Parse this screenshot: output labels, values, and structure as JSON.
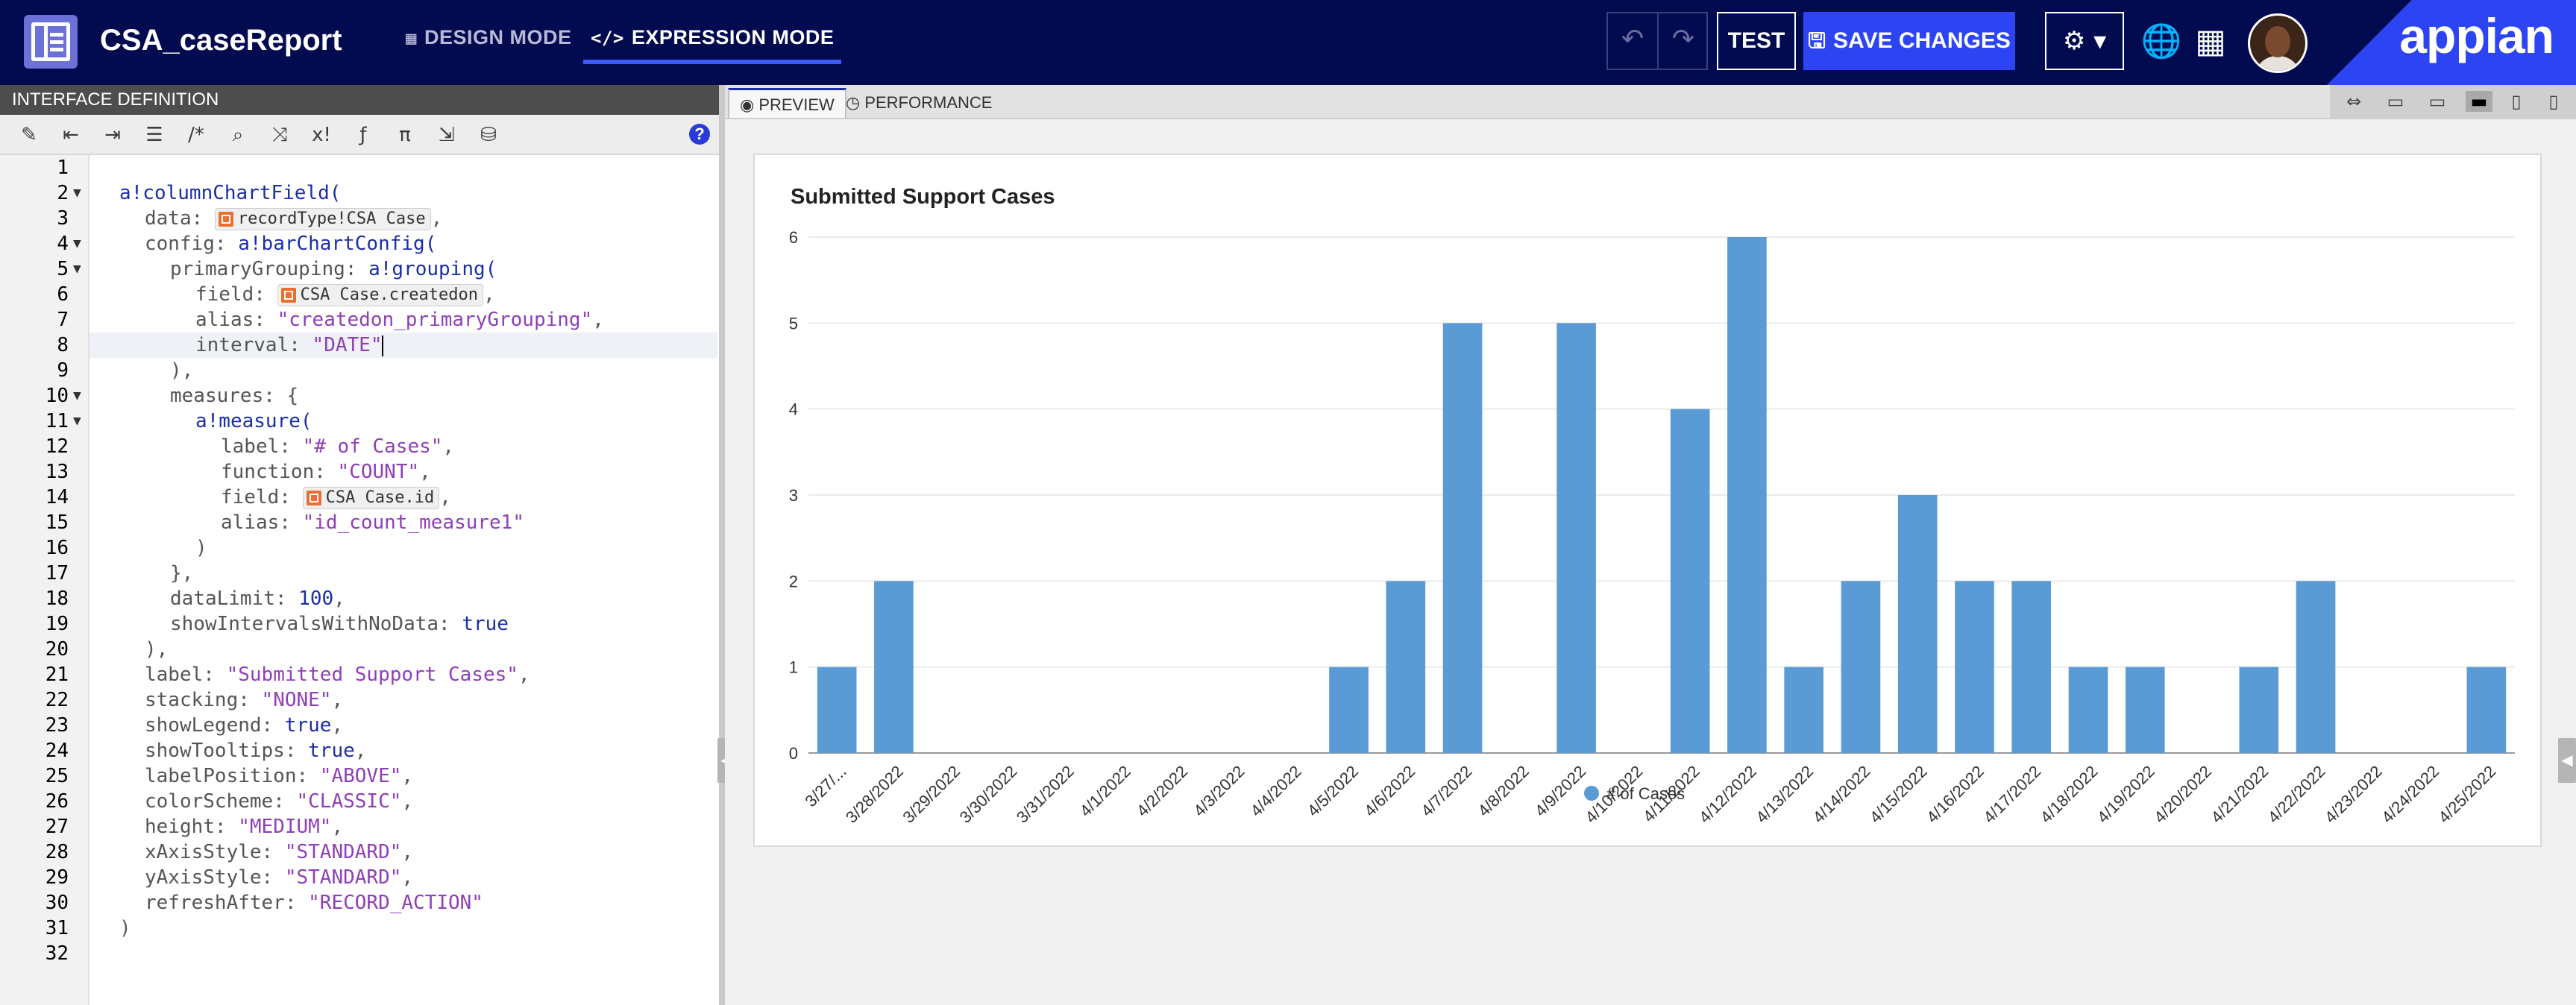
{
  "header": {
    "app_title": "CSA_caseReport",
    "design_mode": "DESIGN MODE",
    "expression_mode": "EXPRESSION MODE",
    "test": "TEST",
    "save": "SAVE CHANGES",
    "brand": "appian"
  },
  "left_panel": {
    "title": "INTERFACE DEFINITION",
    "tools": [
      "wand-icon",
      "outdent-icon",
      "indent-icon",
      "list-icon",
      "comment-icon",
      "search-icon",
      "shuffle-icon",
      "x-exclaim-icon",
      "fx-icon",
      "pi-icon",
      "export-icon",
      "database-search-icon"
    ],
    "line_numbers": [
      "1",
      "2",
      "3",
      "4",
      "5",
      "6",
      "7",
      "8",
      "9",
      "10",
      "11",
      "12",
      "13",
      "14",
      "15",
      "16",
      "17",
      "18",
      "19",
      "20",
      "21",
      "22",
      "23",
      "24",
      "25",
      "26",
      "27",
      "28",
      "29",
      "30",
      "31",
      "32"
    ],
    "code": {
      "l2_fn": "a!columnChartField(",
      "l3_key": "data: ",
      "l3_token": "recordType!CSA Case",
      "l3_end": ",",
      "l4_key": "config: ",
      "l4_fn": "a!barChartConfig(",
      "l5_key": "primaryGrouping: ",
      "l5_fn": "a!grouping(",
      "l6_key": "field: ",
      "l6_token": "CSA Case.createdon",
      "l6_end": ",",
      "l7_key": "alias: ",
      "l7_val": "\"createdon_primaryGrouping\"",
      "l7_end": ",",
      "l8_key": "interval: ",
      "l8_val": "\"DATE\"",
      "l9": "),",
      "l10_key": "measures: ",
      "l10_end": "{",
      "l11_fn": "a!measure(",
      "l12_key": "label: ",
      "l12_val": "\"# of Cases\"",
      "l12_end": ",",
      "l13_key": "function: ",
      "l13_val": "\"COUNT\"",
      "l13_end": ",",
      "l14_key": "field: ",
      "l14_token": "CSA Case.id",
      "l14_end": ",",
      "l15_key": "alias: ",
      "l15_val": "\"id_count_measure1\"",
      "l16": ")",
      "l17": "},",
      "l18_key": "dataLimit: ",
      "l18_val": "100",
      "l18_end": ",",
      "l19_key": "showIntervalsWithNoData: ",
      "l19_val": "true",
      "l20": "),",
      "l21_key": "label: ",
      "l21_val": "\"Submitted Support Cases\"",
      "l21_end": ",",
      "l22_key": "stacking: ",
      "l22_val": "\"NONE\"",
      "l22_end": ",",
      "l23_key": "showLegend: ",
      "l23_val": "true",
      "l23_end": ",",
      "l24_key": "showTooltips: ",
      "l24_val": "true",
      "l24_end": ",",
      "l25_key": "labelPosition: ",
      "l25_val": "\"ABOVE\"",
      "l25_end": ",",
      "l26_key": "colorScheme: ",
      "l26_val": "\"CLASSIC\"",
      "l26_end": ",",
      "l27_key": "height: ",
      "l27_val": "\"MEDIUM\"",
      "l27_end": ",",
      "l28_key": "xAxisStyle: ",
      "l28_val": "\"STANDARD\"",
      "l28_end": ",",
      "l29_key": "yAxisStyle: ",
      "l29_val": "\"STANDARD\"",
      "l29_end": ",",
      "l30_key": "refreshAfter: ",
      "l30_val": "\"RECORD_ACTION\"",
      "l31": ")"
    }
  },
  "right_panel": {
    "tabs": [
      "PREVIEW",
      "PERFORMANCE"
    ],
    "devices": [
      "fit-width-icon",
      "desktop-wide-icon",
      "desktop-icon",
      "laptop-icon",
      "tablet-icon",
      "phone-icon"
    ]
  },
  "colors": {
    "bar": "#5b9bd5",
    "header": "#020a50",
    "accent": "#2d44f2"
  },
  "chart_data": {
    "type": "bar",
    "title": "Submitted Support Cases",
    "categories": [
      "3/27/...",
      "3/28/2022",
      "3/29/2022",
      "3/30/2022",
      "3/31/2022",
      "4/1/2022",
      "4/2/2022",
      "4/3/2022",
      "4/4/2022",
      "4/5/2022",
      "4/6/2022",
      "4/7/2022",
      "4/8/2022",
      "4/9/2022",
      "4/10/2022",
      "4/11/2022",
      "4/12/2022",
      "4/13/2022",
      "4/14/2022",
      "4/15/2022",
      "4/16/2022",
      "4/17/2022",
      "4/18/2022",
      "4/19/2022",
      "4/20/2022",
      "4/21/2022",
      "4/22/2022",
      "4/23/2022",
      "4/24/2022",
      "4/25/2022"
    ],
    "series": [
      {
        "name": "# of Cases",
        "values": [
          1,
          2,
          0,
          0,
          0,
          0,
          0,
          0,
          0,
          1,
          2,
          5,
          0,
          5,
          0,
          4,
          6,
          1,
          2,
          3,
          2,
          2,
          1,
          1,
          0,
          1,
          2,
          0,
          0,
          1
        ]
      }
    ],
    "ylim": [
      0,
      6
    ],
    "yticks": [
      "0",
      "1",
      "2",
      "3",
      "4",
      "5",
      "6"
    ],
    "grid": true,
    "legend": "bottom-center"
  }
}
